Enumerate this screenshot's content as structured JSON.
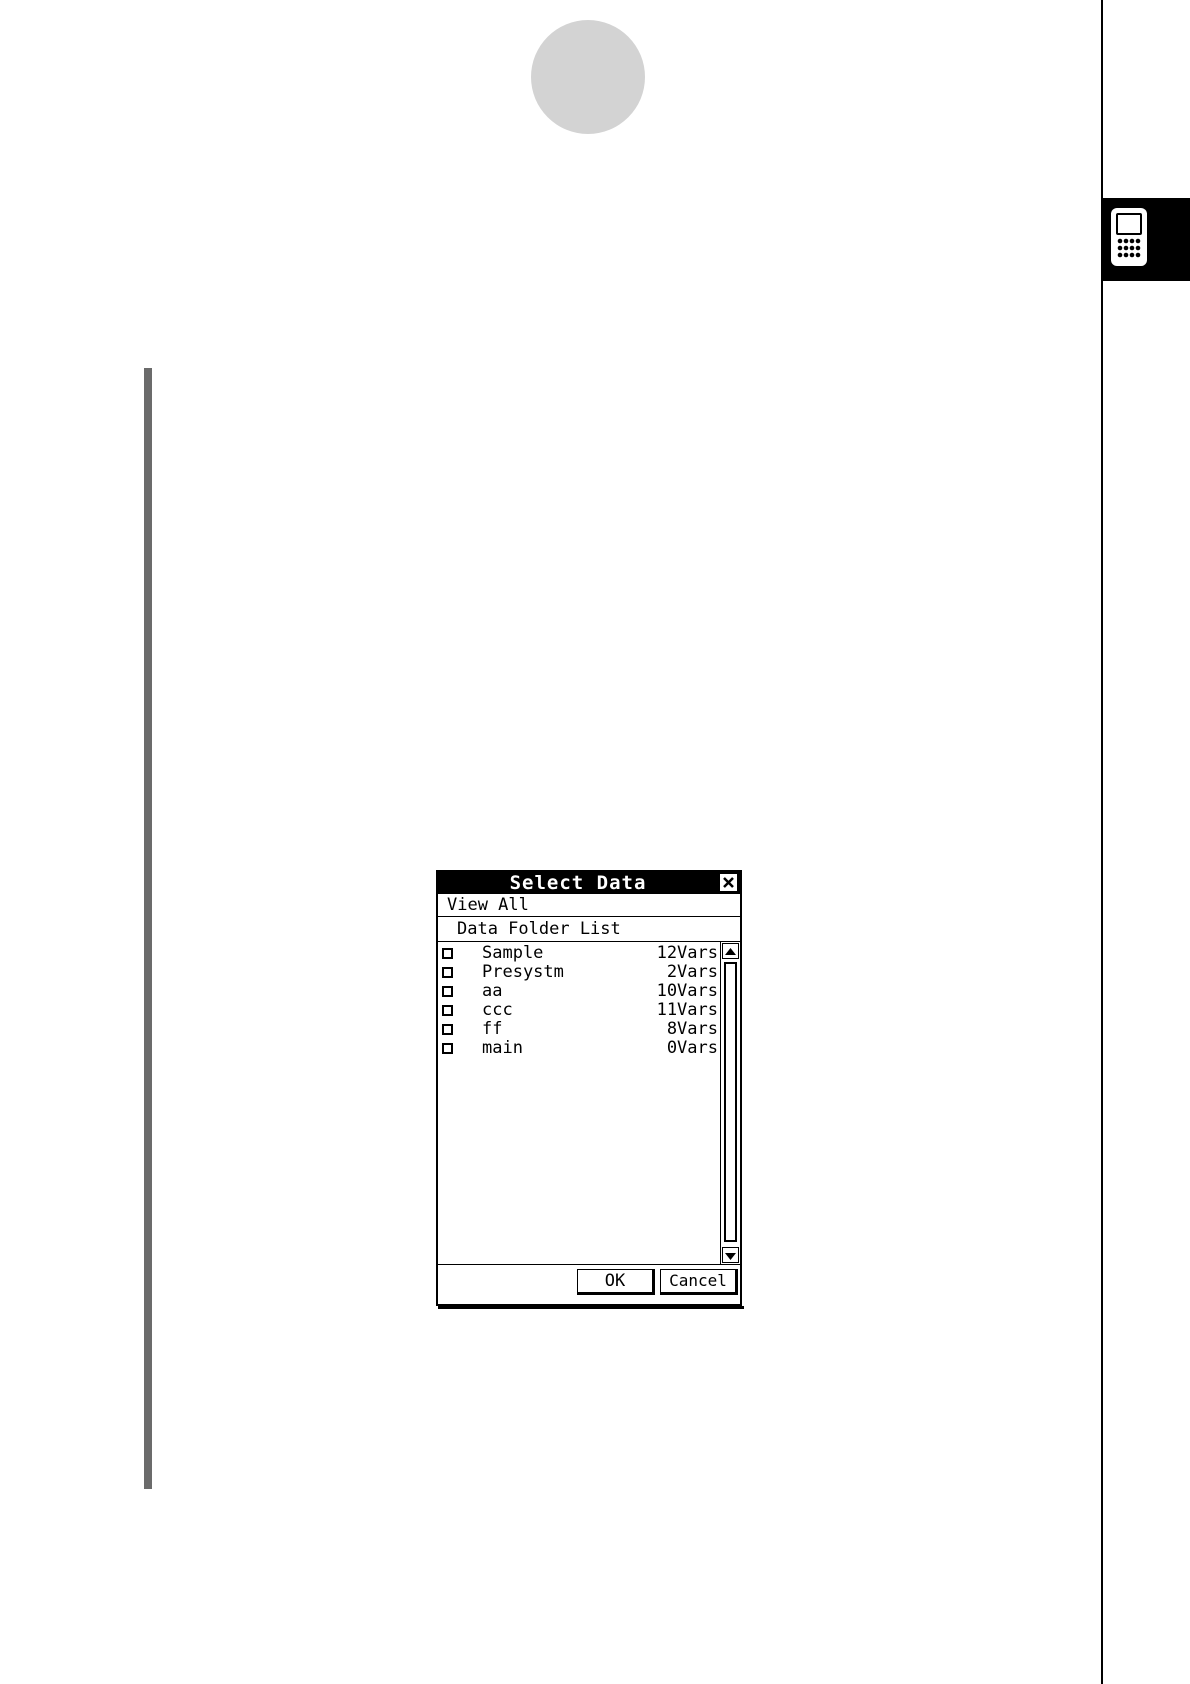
{
  "dialog": {
    "title": "Select Data",
    "menu": {
      "view_label": "View All"
    },
    "list_header": "Data Folder List",
    "rows": [
      {
        "name": "Sample",
        "count": "12Vars"
      },
      {
        "name": "Presystm",
        "count": "2Vars"
      },
      {
        "name": "aa",
        "count": "10Vars"
      },
      {
        "name": "ccc",
        "count": "11Vars"
      },
      {
        "name": "ff",
        "count": "8Vars"
      },
      {
        "name": "main",
        "count": "0Vars"
      }
    ],
    "buttons": {
      "ok": "OK",
      "cancel": "Cancel"
    }
  },
  "icons": {
    "close": "close-icon",
    "scroll_up": "scroll-up-arrow-icon",
    "scroll_down": "scroll-down-arrow-icon",
    "calculator": "calculator-icon"
  }
}
